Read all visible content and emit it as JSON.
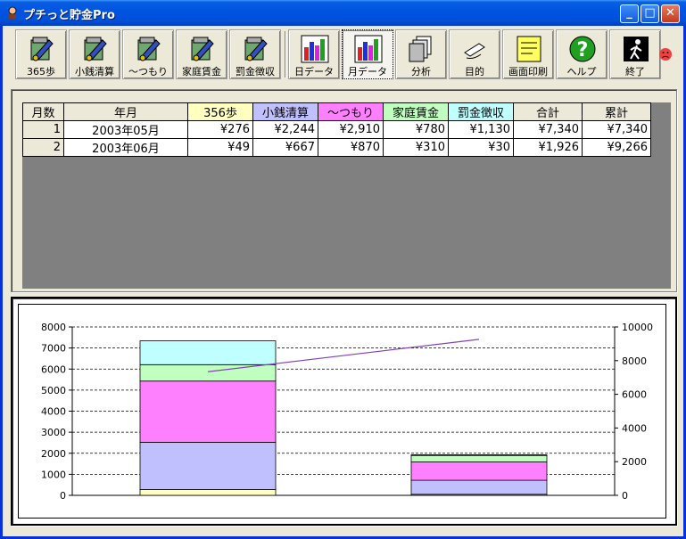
{
  "window": {
    "title": "プチっと貯金Pro"
  },
  "titlebar_buttons": {
    "minimize": "_",
    "maximize": "□",
    "close": "✕"
  },
  "toolbar": [
    {
      "name": "365steps",
      "label": "365歩",
      "icon": "notepad-pen-icon"
    },
    {
      "name": "small-change",
      "label": "小銭清算",
      "icon": "notepad-pen-icon"
    },
    {
      "name": "tsumori",
      "label": "〜つもり",
      "icon": "notepad-pen-icon"
    },
    {
      "name": "family-rent",
      "label": "家庭賃金",
      "icon": "notepad-pen-icon"
    },
    {
      "name": "fine",
      "label": "罰金徴収",
      "icon": "notepad-pen-icon"
    },
    {
      "name": "day-data",
      "label": "日データ",
      "icon": "bar-chart-icon"
    },
    {
      "name": "month-data",
      "label": "月データ",
      "icon": "bar-chart-icon"
    },
    {
      "name": "analysis",
      "label": "分析",
      "icon": "documents-icon"
    },
    {
      "name": "purpose",
      "label": "目的",
      "icon": "pen-icon"
    },
    {
      "name": "print",
      "label": "画面印刷",
      "icon": "memo-icon"
    },
    {
      "name": "help",
      "label": "ヘルプ",
      "icon": "help-icon"
    },
    {
      "name": "exit",
      "label": "終了",
      "icon": "exit-icon"
    }
  ],
  "table": {
    "headers": [
      "月数",
      "年月",
      "356歩",
      "小銭清算",
      "〜つもり",
      "家庭賃金",
      "罰金徴収",
      "合計",
      "累計"
    ],
    "header_colors": [
      "#ece9d8",
      "#ece9d8",
      "#ffffc0",
      "#c0c0ff",
      "#ff80ff",
      "#c0ffc0",
      "#c0ffff",
      "#ece9d8",
      "#ece9d8"
    ],
    "rows": [
      [
        "1",
        "2003年05月",
        "¥276",
        "¥2,244",
        "¥2,910",
        "¥780",
        "¥1,130",
        "¥7,340",
        "¥7,340"
      ],
      [
        "2",
        "2003年06月",
        "¥49",
        "¥667",
        "¥870",
        "¥310",
        "¥30",
        "¥1,926",
        "¥9,266"
      ]
    ]
  },
  "chart_data": {
    "type": "bar",
    "stacked": true,
    "categories": [
      "2003年05月",
      "2003年06月"
    ],
    "series": [
      {
        "values": [
          276,
          49
        ],
        "color": "#ffffc0"
      },
      {
        "values": [
          2244,
          667
        ],
        "color": "#c0c0ff"
      },
      {
        "values": [
          2910,
          870
        ],
        "color": "#ff80ff"
      },
      {
        "values": [
          780,
          310
        ],
        "color": "#c0ffc0"
      },
      {
        "values": [
          1130,
          30
        ],
        "color": "#c0ffff"
      }
    ],
    "line": {
      "values": [
        7340,
        9266
      ],
      "color": "#8040c0",
      "axis": "right"
    },
    "ylim": [
      0,
      8000
    ],
    "y_ticks": [
      0,
      1000,
      2000,
      3000,
      4000,
      5000,
      6000,
      7000,
      8000
    ],
    "y2lim": [
      0,
      10000
    ],
    "y2_ticks": [
      0,
      2000,
      4000,
      6000,
      8000,
      10000
    ],
    "grid": true
  }
}
